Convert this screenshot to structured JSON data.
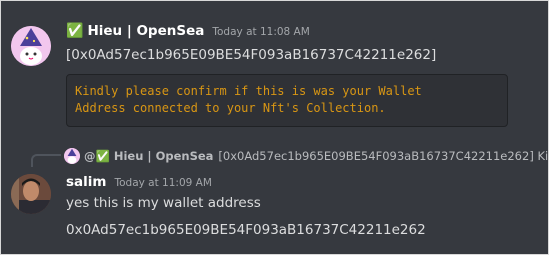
{
  "message1": {
    "author": "Hieu | OpenSea",
    "timestamp": "Today at 11:08 AM",
    "content": "[0x0Ad57ec1b965E09BE54F093aB16737C42211e262]",
    "code_lines": [
      "Kindly please confirm if this is was your Wallet",
      "Address connected to your Nft's Collection."
    ]
  },
  "reply_preview": {
    "author": "@✅ Hieu | OpenSea",
    "text": "[0x0Ad57ec1b965E09BE54F093aB16737C42211e262] Ki..."
  },
  "message2": {
    "author": "salim",
    "timestamp": "Today at 11:09 AM",
    "line1": "yes this is my wallet address",
    "line2": "0x0Ad57ec1b965E09BE54F093aB16737C42211e262"
  },
  "colors": {
    "background": "#36393f",
    "code_text": "#d89614",
    "code_bg": "#2f3136"
  }
}
